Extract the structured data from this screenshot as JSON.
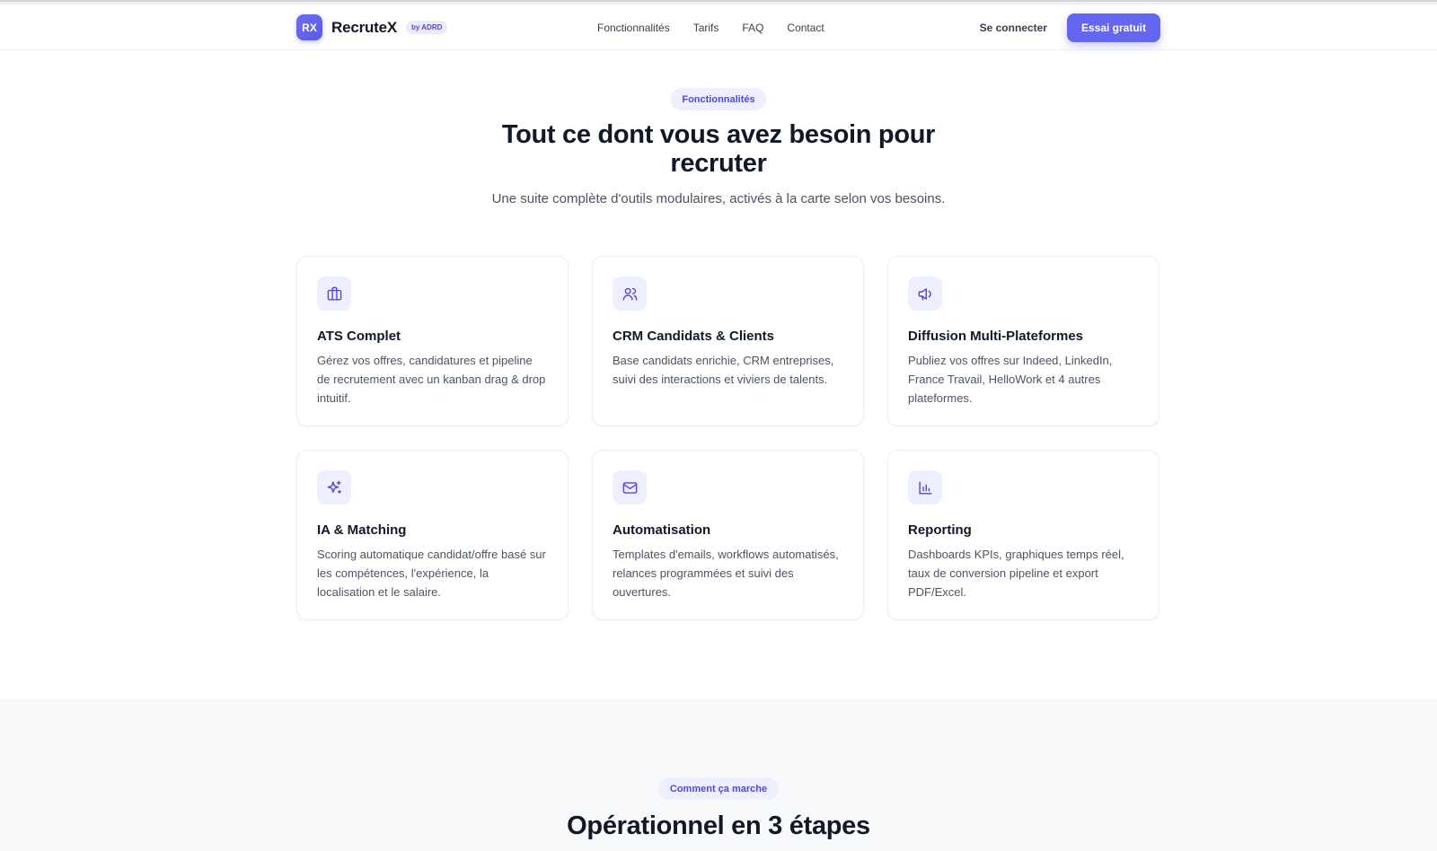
{
  "header": {
    "logo_mark": "RX",
    "brand_name": "RecruteX",
    "brand_badge": "by ADRD",
    "nav": [
      "Fonctionnalités",
      "Tarifs",
      "FAQ",
      "Contact"
    ],
    "login_label": "Se connecter",
    "cta_label": "Essai gratuit"
  },
  "features": {
    "pill": "Fonctionnalités",
    "title": "Tout ce dont vous avez besoin pour recruter",
    "subtitle": "Une suite complète d'outils modulaires, activés à la carte selon vos besoins.",
    "cards": [
      {
        "icon": "briefcase-icon",
        "title": "ATS Complet",
        "desc": "Gérez vos offres, candidatures et pipeline de recrutement avec un kanban drag & drop intuitif."
      },
      {
        "icon": "users-icon",
        "title": "CRM Candidats & Clients",
        "desc": "Base candidats enrichie, CRM entreprises, suivi des interactions et viviers de talents."
      },
      {
        "icon": "megaphone-icon",
        "title": "Diffusion Multi-Plateformes",
        "desc": "Publiez vos offres sur Indeed, LinkedIn, France Travail, HelloWork et 4 autres plateformes."
      },
      {
        "icon": "sparkles-icon",
        "title": "IA & Matching",
        "desc": "Scoring automatique candidat/offre basé sur les compétences, l'expérience, la localisation et le salaire."
      },
      {
        "icon": "mail-icon",
        "title": "Automatisation",
        "desc": "Templates d'emails, workflows automatisés, relances programmées et suivi des ouvertures."
      },
      {
        "icon": "bar-chart-icon",
        "title": "Reporting",
        "desc": "Dashboards KPIs, graphiques temps réel, taux de conversion pipeline et export PDF/Excel."
      }
    ]
  },
  "steps": {
    "pill": "Comment ça marche",
    "title": "Opérationnel en 3 étapes"
  },
  "colors": {
    "accent": "#6366f1",
    "accent_text": "#4f46e5",
    "pill_bg": "#eef0ff"
  }
}
